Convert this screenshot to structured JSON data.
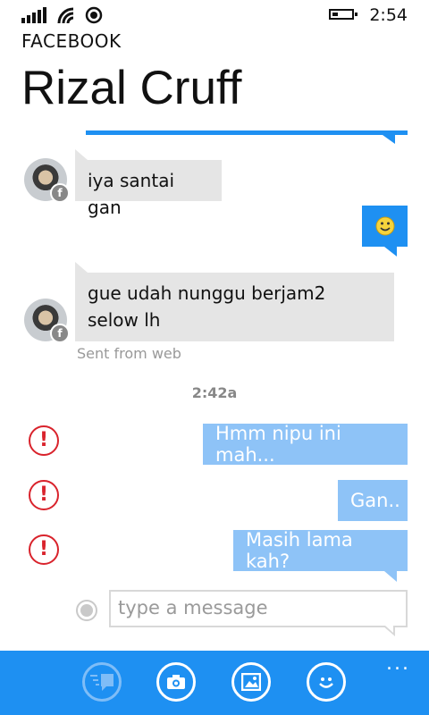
{
  "status_bar": {
    "time": "2:54"
  },
  "app": {
    "title": "FACEBOOK"
  },
  "contact": {
    "name": "Rizal Cruff"
  },
  "messages": [
    {
      "direction": "in",
      "text": "iya santai gan"
    },
    {
      "direction": "out",
      "type": "emoji",
      "emoji": "smiley"
    },
    {
      "direction": "in",
      "text": "gue udah nunggu berjam2 selow lh",
      "meta": "Sent from web"
    }
  ],
  "timestamp": "2:42a",
  "failed_messages": [
    {
      "text": "Hmm nipu ini mah..."
    },
    {
      "text": "Gan.."
    },
    {
      "text": "Masih lama kah?"
    }
  ],
  "compose": {
    "placeholder": "type a message"
  },
  "app_bar": {
    "buttons": [
      "messages-icon",
      "camera-icon",
      "photo-icon",
      "smiley-icon"
    ],
    "more": "..."
  },
  "colors": {
    "accent": "#1e90f2",
    "outgoing": "#8ec3f7",
    "incoming": "#e5e5e5",
    "error": "#d9232c"
  }
}
